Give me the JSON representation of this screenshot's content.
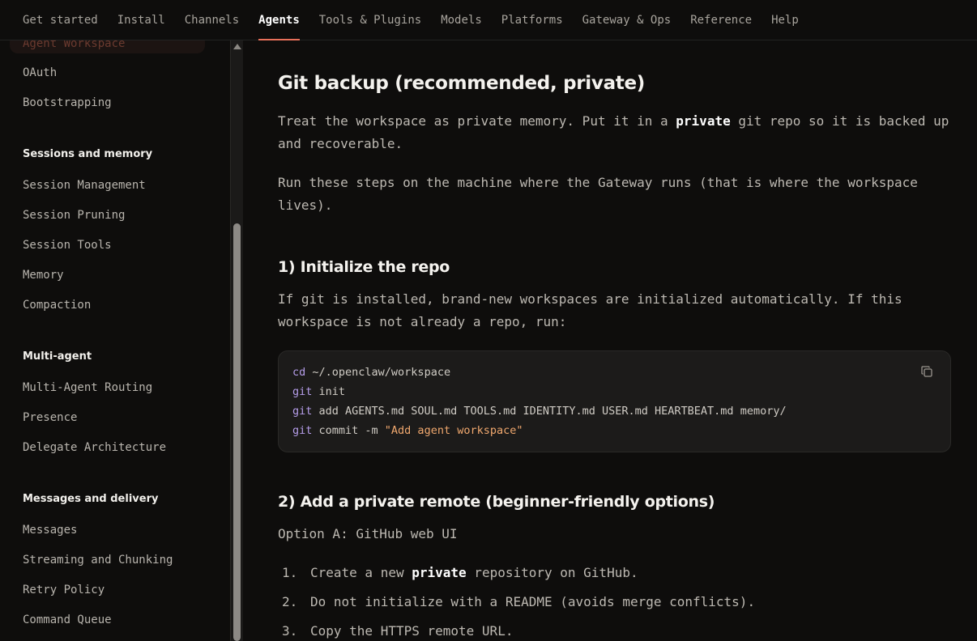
{
  "nav": {
    "tabs": [
      {
        "label": "Get started"
      },
      {
        "label": "Install"
      },
      {
        "label": "Channels"
      },
      {
        "label": "Agents",
        "active": true
      },
      {
        "label": "Tools & Plugins"
      },
      {
        "label": "Models"
      },
      {
        "label": "Platforms"
      },
      {
        "label": "Gateway & Ops"
      },
      {
        "label": "Reference"
      },
      {
        "label": "Help"
      }
    ],
    "accent_color": "#e8705a"
  },
  "sidebar": {
    "partial_item": "Agent Workspace",
    "top_items": [
      "OAuth",
      "Bootstrapping"
    ],
    "sessions_heading": "Sessions and memory",
    "sessions_items": [
      "Session Management",
      "Session Pruning",
      "Session Tools",
      "Memory",
      "Compaction"
    ],
    "multiagent_heading": "Multi-agent",
    "multiagent_items": [
      "Multi-Agent Routing",
      "Presence",
      "Delegate Architecture"
    ],
    "messages_heading": "Messages and delivery",
    "messages_items": [
      "Messages",
      "Streaming and Chunking",
      "Retry Policy",
      "Command Queue"
    ]
  },
  "content": {
    "title": "Git backup (recommended, private)",
    "intro_pre": "Treat the workspace as private memory. Put it in a ",
    "intro_bold": "private",
    "intro_post": " git repo so it is backed up and recoverable.",
    "run_note": "Run these steps on the machine where the Gateway runs (that is where the workspace lives).",
    "step1_title": "1) Initialize the repo",
    "step1_text": "If git is installed, brand-new workspaces are initialized automatically. If this workspace is not already a repo, run:",
    "code": {
      "line1_cmd": "cd",
      "line1_rest": " ~/.openclaw/workspace",
      "line2_cmd": "git",
      "line2_rest": " init",
      "line3_cmd": "git",
      "line3_rest": " add AGENTS.md SOUL.md TOOLS.md IDENTITY.md USER.md HEARTBEAT.md memory/",
      "line4_cmd": "git",
      "line4_rest": " commit -m ",
      "line4_str": "\"Add agent workspace\"",
      "copy_icon": "copy-icon"
    },
    "step2_title": "2) Add a private remote (beginner-friendly options)",
    "option_a": "Option A: GitHub web UI",
    "list": [
      {
        "num": "1.",
        "pre": "Create a new ",
        "bold": "private",
        "post": " repository on GitHub."
      },
      {
        "num": "2.",
        "pre": "Do not initialize with a README (avoids merge conflicts).",
        "bold": "",
        "post": ""
      },
      {
        "num": "3.",
        "pre": "Copy the HTTPS remote URL.",
        "bold": "",
        "post": ""
      }
    ]
  }
}
